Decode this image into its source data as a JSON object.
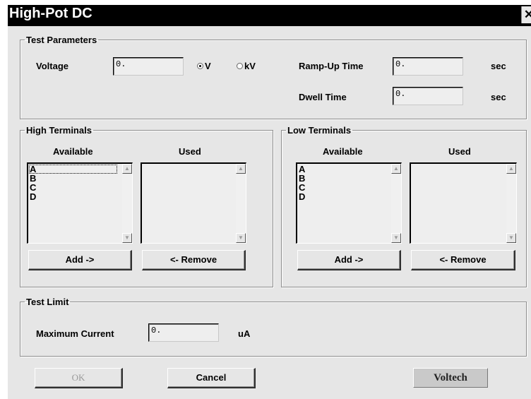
{
  "window": {
    "title": "High-Pot DC",
    "close_glyph": "✕"
  },
  "test_parameters": {
    "legend": "Test Parameters",
    "voltage_label": "Voltage",
    "voltage_value": "0.",
    "unit_options": [
      {
        "label": "V",
        "selected": true
      },
      {
        "label": "kV",
        "selected": false
      }
    ],
    "ramp_label": "Ramp-Up Time",
    "ramp_value": "0.",
    "ramp_unit": "sec",
    "dwell_label": "Dwell Time",
    "dwell_value": "0.",
    "dwell_unit": "sec"
  },
  "high_terminals": {
    "legend": "High Terminals",
    "available_header": "Available",
    "used_header": "Used",
    "available": [
      "A",
      "B",
      "C",
      "D"
    ],
    "used": [],
    "add_label": "Add ->",
    "remove_label": "<- Remove"
  },
  "low_terminals": {
    "legend": "Low Terminals",
    "available_header": "Available",
    "used_header": "Used",
    "available": [
      "A",
      "B",
      "C",
      "D"
    ],
    "used": [],
    "add_label": "Add ->",
    "remove_label": "<- Remove"
  },
  "test_limit": {
    "legend": "Test Limit",
    "max_current_label": "Maximum Current",
    "max_current_value": "0.",
    "max_current_unit": "uA"
  },
  "footer": {
    "ok_label": "OK",
    "ok_enabled": false,
    "cancel_label": "Cancel",
    "brand": "Voltech"
  },
  "icons": {
    "scroll_up": "up-arrow-icon",
    "scroll_down": "down-arrow-icon",
    "radio": "radio-icon"
  },
  "colors": {
    "titlebar_bg": "#000000",
    "dialog_bg": "#e6e6e6",
    "field_bg": "#eeeeee"
  }
}
